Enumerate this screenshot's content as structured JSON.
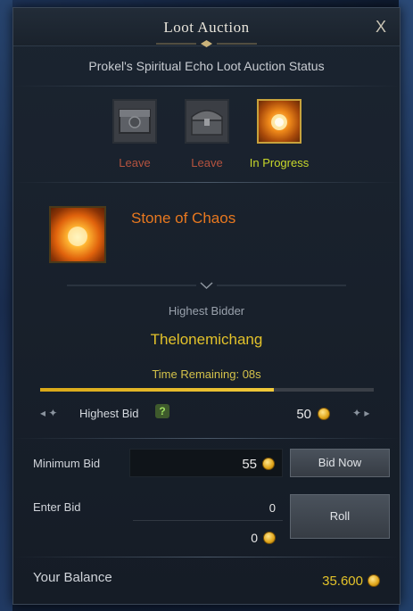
{
  "window": {
    "title": "Loot Auction",
    "close_label": "X",
    "subtitle": "Prokel's Spiritual Echo Loot Auction Status"
  },
  "loot_slots": [
    {
      "label": "Leave",
      "icon": "gray-chest-icon",
      "state": "leave"
    },
    {
      "label": "Leave",
      "icon": "treasure-chest-icon",
      "state": "leave"
    },
    {
      "label": "In Progress",
      "icon": "stone-of-chaos-icon",
      "state": "in-progress"
    }
  ],
  "current_item": {
    "name": "Stone of Chaos",
    "icon": "stone-of-chaos-icon"
  },
  "bidder": {
    "label": "Highest Bidder",
    "name": "Thelonemichang",
    "time_remaining": "Time Remaining: 08s",
    "time_progress": 0.7
  },
  "highest_bid": {
    "label": "Highest Bid",
    "help": "?",
    "value": "50"
  },
  "minimum_bid": {
    "label": "Minimum Bid",
    "value": "55",
    "button": "Bid Now"
  },
  "enter_bid": {
    "label": "Enter Bid",
    "value": "0",
    "total": "0",
    "button": "Roll"
  },
  "balance": {
    "label": "Your Balance",
    "value": "35.600"
  },
  "colors": {
    "leave": "#b5533f",
    "in_progress": "#c8d82a",
    "item_name": "#e8781f",
    "bidder_name": "#e3c22a",
    "gold": "#e3c22a"
  }
}
